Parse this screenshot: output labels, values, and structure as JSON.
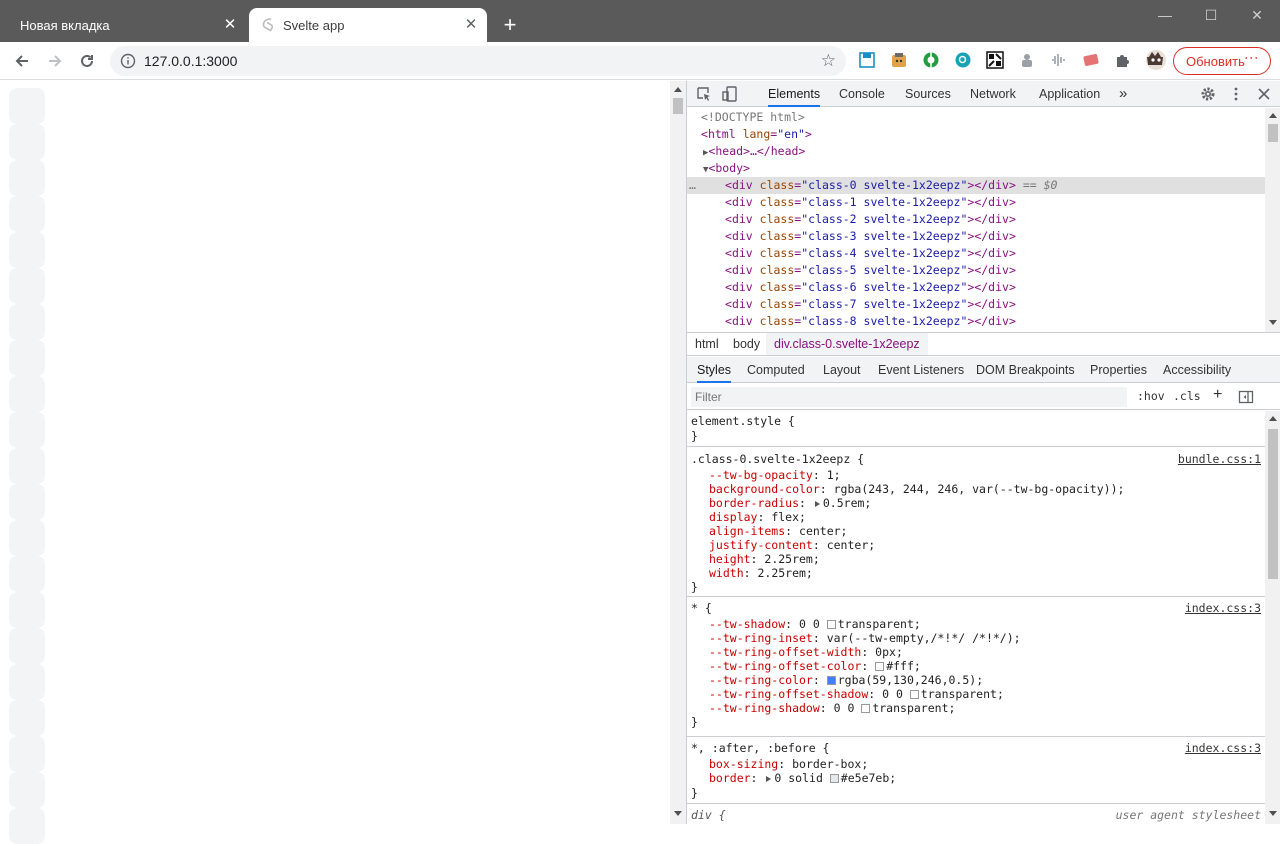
{
  "browser": {
    "tabs": [
      {
        "title": "Новая вкладка",
        "active": false
      },
      {
        "title": "Svelte app",
        "active": true
      }
    ],
    "new_tab_symbol": "+",
    "close_symbol": "✕",
    "window_controls": {
      "minimize": "—",
      "maximize": "☐",
      "close": "✕"
    },
    "url": "127.0.0.1:3000",
    "update_button": "Обновить",
    "extension_icons": [
      "save-disk-icon",
      "cat-face-icon",
      "green-circle-icon",
      "teal-search-icon",
      "qr-icon",
      "puzzle-bear-icon",
      "soundwave-icon",
      "red-tag-icon",
      "puzzle-icon",
      "avatar-icon"
    ]
  },
  "page": {
    "box_color": "#f3f4f6",
    "box_count": 21
  },
  "devtools": {
    "tabs": [
      "Elements",
      "Console",
      "Sources",
      "Network",
      "Application"
    ],
    "overflow": "»",
    "settings_icon": "gear-icon",
    "menu_icon": "kebab-icon",
    "close_icon": "close-icon",
    "elements_tree": {
      "doctype": "<!DOCTYPE html>",
      "html_open": "<html lang=\"en\">",
      "head": "<head>…</head>",
      "body_open": "<body>",
      "selected_suffix": "== $0",
      "divs": [
        "class-0 svelte-1x2eepz",
        "class-1 svelte-1x2eepz",
        "class-2 svelte-1x2eepz",
        "class-3 svelte-1x2eepz",
        "class-4 svelte-1x2eepz",
        "class-5 svelte-1x2eepz",
        "class-6 svelte-1x2eepz",
        "class-7 svelte-1x2eepz",
        "class-8 svelte-1x2eepz"
      ]
    },
    "breadcrumb": [
      "html",
      "body",
      "div.class-0.svelte-1x2eepz"
    ],
    "sub_tabs": [
      "Styles",
      "Computed",
      "Layout",
      "Event Listeners",
      "DOM Breakpoints",
      "Properties",
      "Accessibility"
    ],
    "filter_placeholder": "Filter",
    "hov": ":hov",
    "cls": ".cls",
    "plus": "+",
    "styles": {
      "element_style": {
        "selector": "element.style {",
        "close": "}"
      },
      "class_rule": {
        "selector": ".class-0.svelte-1x2eepz {",
        "source": "bundle.css:1",
        "props": [
          {
            "name": "--tw-bg-opacity",
            "value": "1;"
          },
          {
            "name": "background-color",
            "value": "rgba(243, 244, 246, var(--tw-bg-opacity));"
          },
          {
            "name": "border-radius",
            "value": "0.5rem;",
            "triangle": true
          },
          {
            "name": "display",
            "value": "flex;"
          },
          {
            "name": "align-items",
            "value": "center;"
          },
          {
            "name": "justify-content",
            "value": "center;"
          },
          {
            "name": "height",
            "value": "2.25rem;"
          },
          {
            "name": "width",
            "value": "2.25rem;"
          }
        ],
        "close": "}"
      },
      "star_rule": {
        "selector": "* {",
        "source": "index.css:3",
        "props": [
          {
            "name": "--tw-shadow",
            "pre": "0 0",
            "swatch": "#ffffff",
            "value": "transparent;"
          },
          {
            "name": "--tw-ring-inset",
            "value": "var(--tw-empty,/*!*/ /*!*/);"
          },
          {
            "name": "--tw-ring-offset-width",
            "value": "0px;"
          },
          {
            "name": "--tw-ring-offset-color",
            "swatch": "#ffffff",
            "value": "#fff;"
          },
          {
            "name": "--tw-ring-color",
            "swatch": "#3b82f6",
            "value": "rgba(59,130,246,0.5);"
          },
          {
            "name": "--tw-ring-offset-shadow",
            "pre": "0 0",
            "swatch": "#ffffff",
            "value": "transparent;"
          },
          {
            "name": "--tw-ring-shadow",
            "pre": "0 0",
            "swatch": "#ffffff",
            "value": "transparent;"
          }
        ],
        "close": "}"
      },
      "before_after_rule": {
        "selector": "*, :after, :before {",
        "source": "index.css:3",
        "props": [
          {
            "name": "box-sizing",
            "value": "border-box;"
          },
          {
            "name": "border",
            "triangle": true,
            "pre": "0 solid",
            "swatch": "#e5e7eb",
            "value": "#e5e7eb;"
          }
        ]
      },
      "div_rule": {
        "selector": "div {",
        "source": "user agent stylesheet"
      }
    }
  }
}
